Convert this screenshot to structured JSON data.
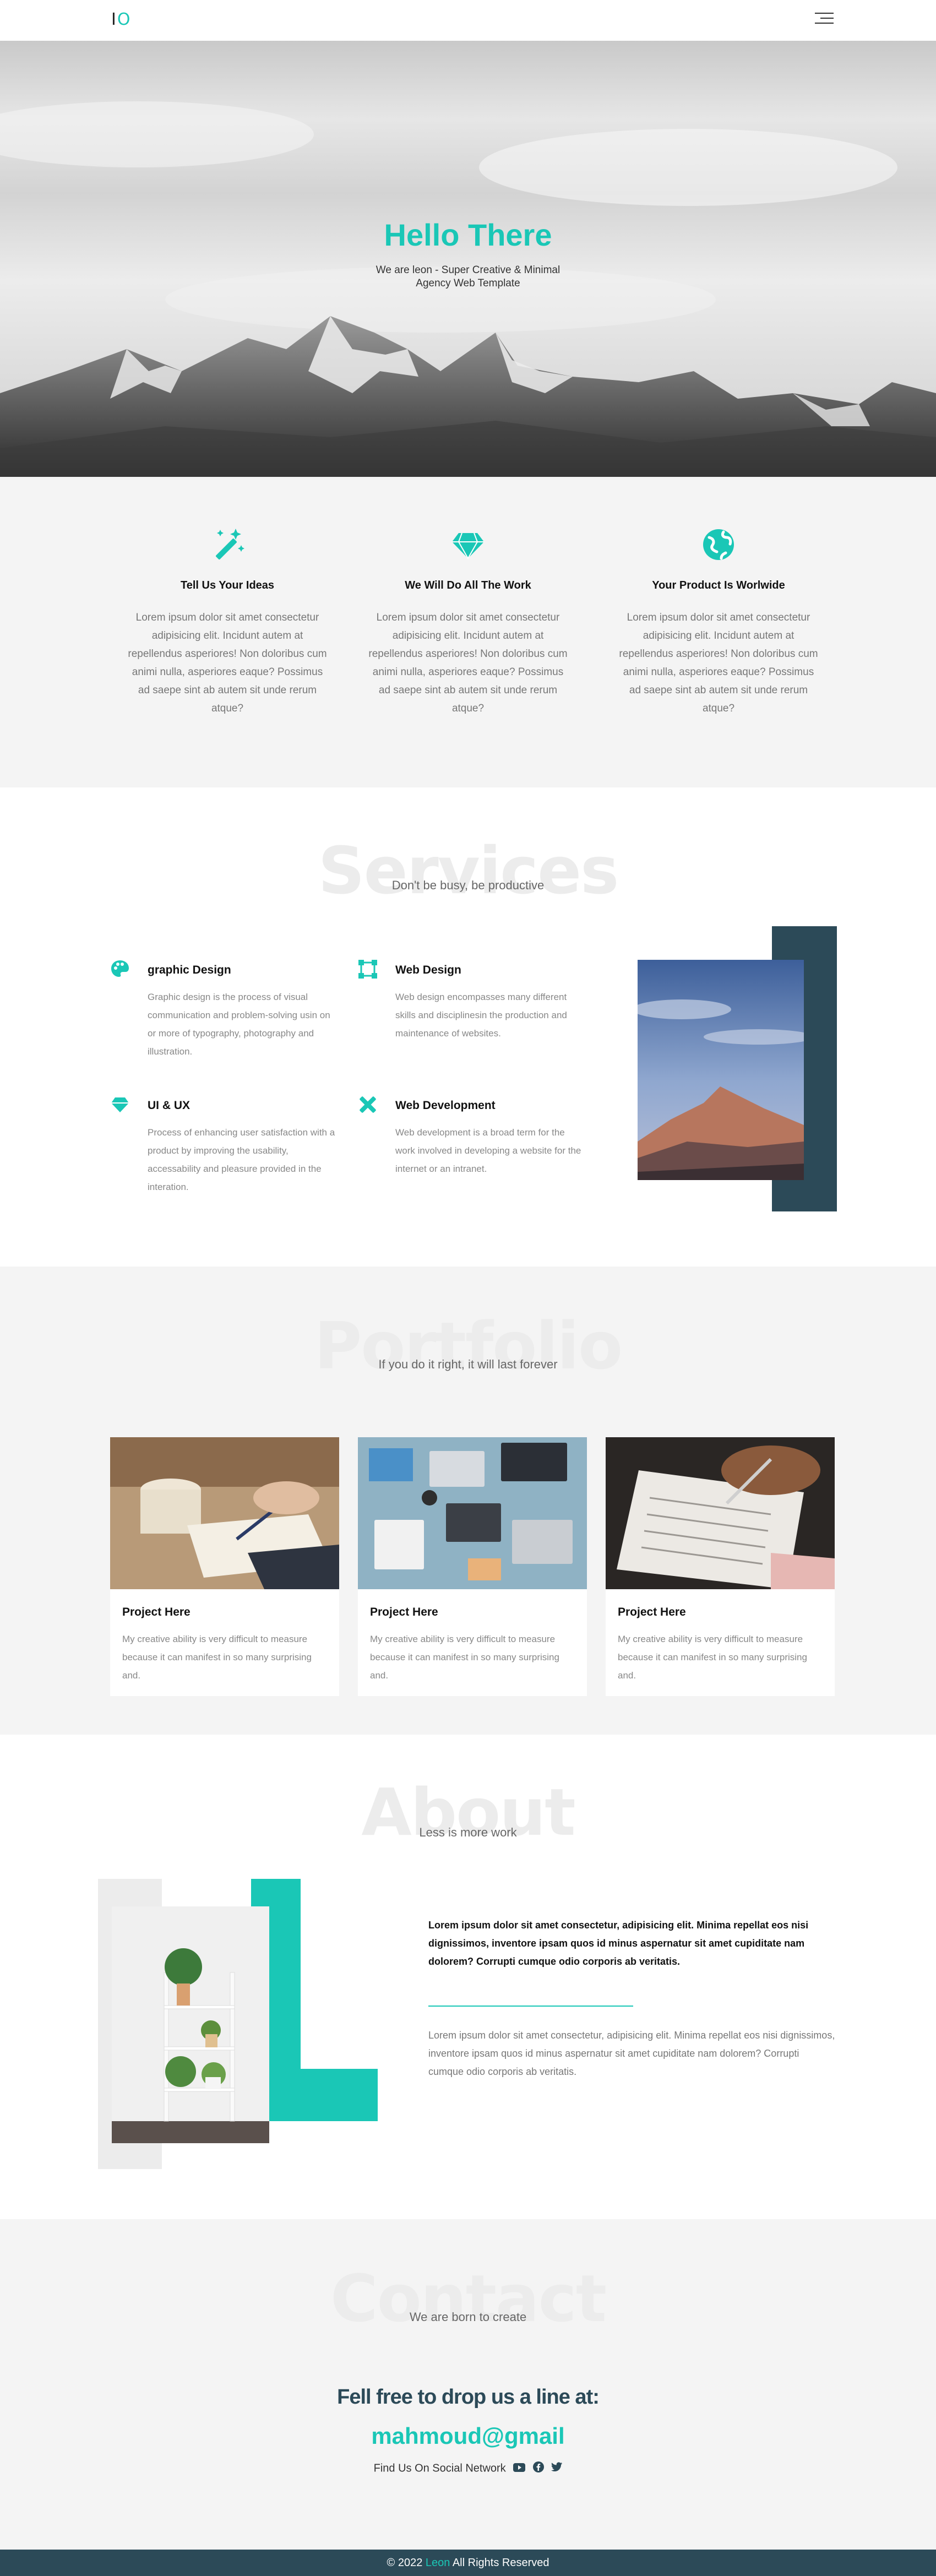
{
  "nav": {
    "logo_i": "I",
    "logo_o": "O"
  },
  "hero": {
    "title": "Hello There",
    "subtitle": "We are leon - Super Creative & Minimal Agency Web Template"
  },
  "features": [
    {
      "icon": "magic-wand-icon",
      "title": "Tell Us Your Ideas",
      "text": "Lorem ipsum dolor sit amet consectetur adipisicing elit. Incidunt autem at repellendus asperiores! Non doloribus cum animi nulla, asperiores eaque? Possimus ad saepe sint ab autem sit unde rerum atque?"
    },
    {
      "icon": "diamond-icon",
      "title": "We Will Do All The Work",
      "text": "Lorem ipsum dolor sit amet consectetur adipisicing elit. Incidunt autem at repellendus asperiores! Non doloribus cum animi nulla, asperiores eaque? Possimus ad saepe sint ab autem sit unde rerum atque?"
    },
    {
      "icon": "globe-icon",
      "title": "Your Product Is Worlwide",
      "text": "Lorem ipsum dolor sit amet consectetur adipisicing elit. Incidunt autem at repellendus asperiores! Non doloribus cum animi nulla, asperiores eaque? Possimus ad saepe sint ab autem sit unde rerum atque?"
    }
  ],
  "services": {
    "heading": "Services",
    "subheading": "Don't be busy, be productive",
    "items": [
      {
        "icon": "palette-icon",
        "title": "graphic Design",
        "text": "Graphic design is the process of visual communication and problem-solving usin on or more of typography, photography and illustration."
      },
      {
        "icon": "vector-square-icon",
        "title": "Web Design",
        "text": "Web design encompasses many different skills and disciplinesin the production and maintenance of websites."
      },
      {
        "icon": "gem-icon",
        "title": "UI & UX",
        "text": "Process of enhancing user satisfaction with a product by improving the usability, accessability and pleasure provided in the interation."
      },
      {
        "icon": "tools-icon",
        "title": "Web Development",
        "text": "Web development is a broad term for the work involved in developing a website for the internet or an intranet."
      }
    ]
  },
  "portfolio": {
    "heading": "Portfolio",
    "subheading": "If you do it right, it will last forever",
    "projects": [
      {
        "title": "Project Here",
        "text": "My creative ability is very difficult to measure because it can manifest in so many surprising and."
      },
      {
        "title": "Project Here",
        "text": "My creative ability is very difficult to measure because it can manifest in so many surprising and."
      },
      {
        "title": "Project Here",
        "text": "My creative ability is very difficult to measure because it can manifest in so many surprising and."
      }
    ]
  },
  "about": {
    "heading": "About",
    "subheading": "Less is more work",
    "bold_text": "Lorem ipsum dolor sit amet consectetur, adipisicing elit. Minima repellat eos nisi dignissimos, inventore ipsam quos id minus aspernatur sit amet cupiditate nam dolorem? Corrupti cumque odio corporis ab veritatis.",
    "text": "Lorem ipsum dolor sit amet consectetur, adipisicing elit. Minima repellat eos nisi dignissimos, inventore ipsam quos id minus aspernatur sit amet cupiditate nam dolorem? Corrupti cumque odio corporis ab veritatis."
  },
  "contact": {
    "heading": "Contact",
    "subheading": "We are born to create",
    "line": "Fell free to drop us a line at:",
    "email": "mahmoud@gmail",
    "social_label": "Find Us On Social Network",
    "social_icons": [
      "youtube-icon",
      "facebook-icon",
      "twitter-icon"
    ]
  },
  "footer": {
    "prefix": "© 2022",
    "brand": "Leon",
    "suffix": "All Rights Reserved"
  },
  "colors": {
    "accent": "#1ac7b6",
    "dark": "#2c4a58",
    "light_bg": "#f4f4f4"
  }
}
